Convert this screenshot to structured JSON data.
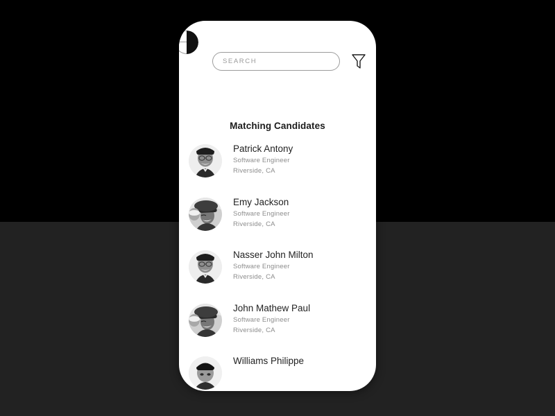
{
  "backdrop": {
    "top_color": "#000000",
    "bottom_color": "#222222"
  },
  "phone": {
    "screen_background": "#ffffff"
  },
  "topbar": {
    "logo_icon": "app-logo-circle-icon",
    "filter_icon": "filter-funnel-icon"
  },
  "search": {
    "value": "",
    "placeholder": "SEARCH"
  },
  "list": {
    "heading": "Matching Candidates",
    "candidates": [
      {
        "name": "Patrick Antony",
        "role": "Software Engineer",
        "location": "Riverside, CA",
        "avatar": "avatar-patrick-antony"
      },
      {
        "name": "Emy Jackson",
        "role": "Software Engineer",
        "location": "Riverside, CA",
        "avatar": "avatar-emy-jackson"
      },
      {
        "name": "Nasser John Milton",
        "role": "Software Engineer",
        "location": "Riverside, CA",
        "avatar": "avatar-nasser-john-milton"
      },
      {
        "name": "John Mathew Paul",
        "role": "Software Engineer",
        "location": "Riverside, CA",
        "avatar": "avatar-john-mathew-paul"
      },
      {
        "name": "Williams Philippe",
        "role": "",
        "location": "",
        "avatar": "avatar-williams-philippe"
      }
    ]
  },
  "colors": {
    "text_primary": "#222222",
    "text_secondary": "#8c8c8c",
    "heading": "#1b1b1b",
    "border": "#9b9b9b"
  }
}
